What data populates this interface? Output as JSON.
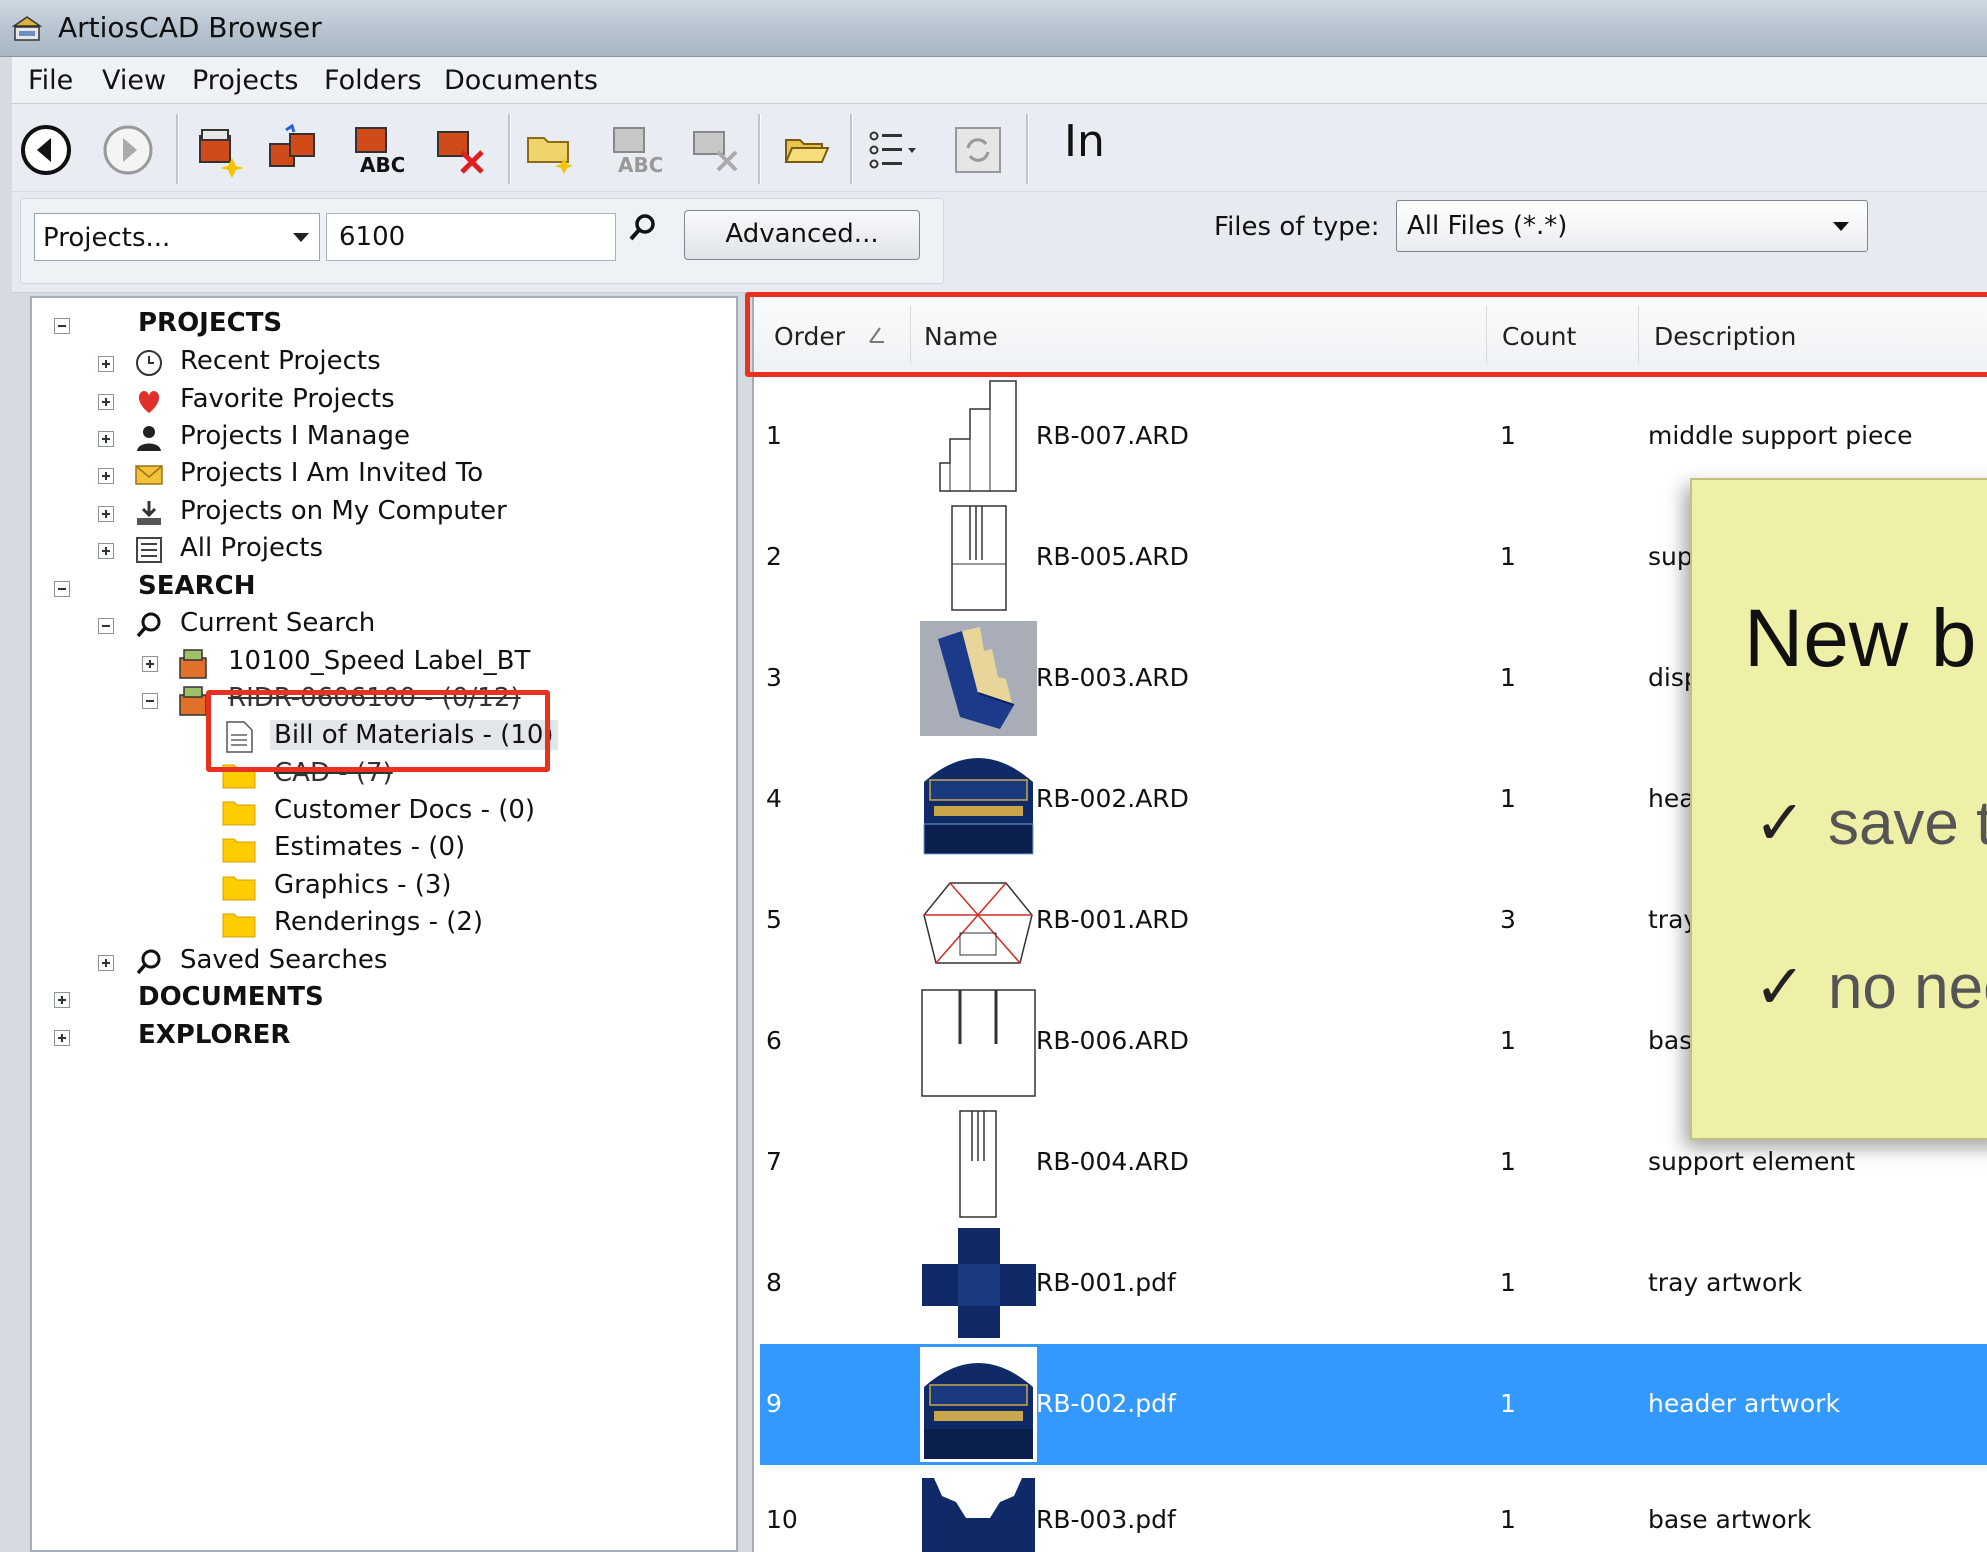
{
  "window": {
    "title": "ArtiosCAD Browser"
  },
  "menu": [
    "File",
    "View",
    "Projects",
    "Folders",
    "Documents"
  ],
  "toolbar": {
    "trailing_text": "In"
  },
  "search": {
    "scope": "Projects...",
    "query": "6100",
    "advanced_label": "Advanced...",
    "filetype_label": "Files of type:",
    "filetype_value": "All Files (*.*)"
  },
  "tree": {
    "projects_header": "PROJECTS",
    "recent": "Recent Projects",
    "favorite": "Favorite Projects",
    "manage": "Projects I Manage",
    "invited": "Projects I Am Invited To",
    "mycomputer": "Projects on My Computer",
    "all": "All Projects",
    "search_header": "SEARCH",
    "current_search": "Current Search",
    "result1": "10100_Speed Label_BT",
    "result2": "RIDR-0606100 - (0/12)",
    "bom": "Bill of Materials - (10)",
    "cad": "CAD - (7)",
    "customer_docs": "Customer Docs - (0)",
    "estimates": "Estimates - (0)",
    "graphics": "Graphics - (3)",
    "renderings": "Renderings - (2)",
    "saved_searches": "Saved Searches",
    "documents_header": "DOCUMENTS",
    "explorer_header": "EXPLORER"
  },
  "list": {
    "columns": {
      "order": "Order",
      "name": "Name",
      "count": "Count",
      "description": "Description"
    },
    "rows": [
      {
        "order": "1",
        "name": "RB-007.ARD",
        "count": "1",
        "description": "middle support piece"
      },
      {
        "order": "2",
        "name": "RB-005.ARD",
        "count": "1",
        "description": "supp"
      },
      {
        "order": "3",
        "name": "RB-003.ARD",
        "count": "1",
        "description": "displ"
      },
      {
        "order": "4",
        "name": "RB-002.ARD",
        "count": "1",
        "description": "head"
      },
      {
        "order": "5",
        "name": "RB-001.ARD",
        "count": "3",
        "description": "tray"
      },
      {
        "order": "6",
        "name": "RB-006.ARD",
        "count": "1",
        "description": "base"
      },
      {
        "order": "7",
        "name": "RB-004.ARD",
        "count": "1",
        "description": "support element"
      },
      {
        "order": "8",
        "name": "RB-001.pdf",
        "count": "1",
        "description": "tray artwork"
      },
      {
        "order": "9",
        "name": "RB-002.pdf",
        "count": "1",
        "description": "header artwork"
      },
      {
        "order": "10",
        "name": "RB-003.pdf",
        "count": "1",
        "description": "base artwork"
      }
    ],
    "selected_row": 9
  },
  "callout": {
    "title": "New b",
    "line1": "save t",
    "line2": "no nee"
  },
  "colors": {
    "highlight": "#e8321d",
    "selection": "#3399ff",
    "note": "#eef0a8"
  }
}
